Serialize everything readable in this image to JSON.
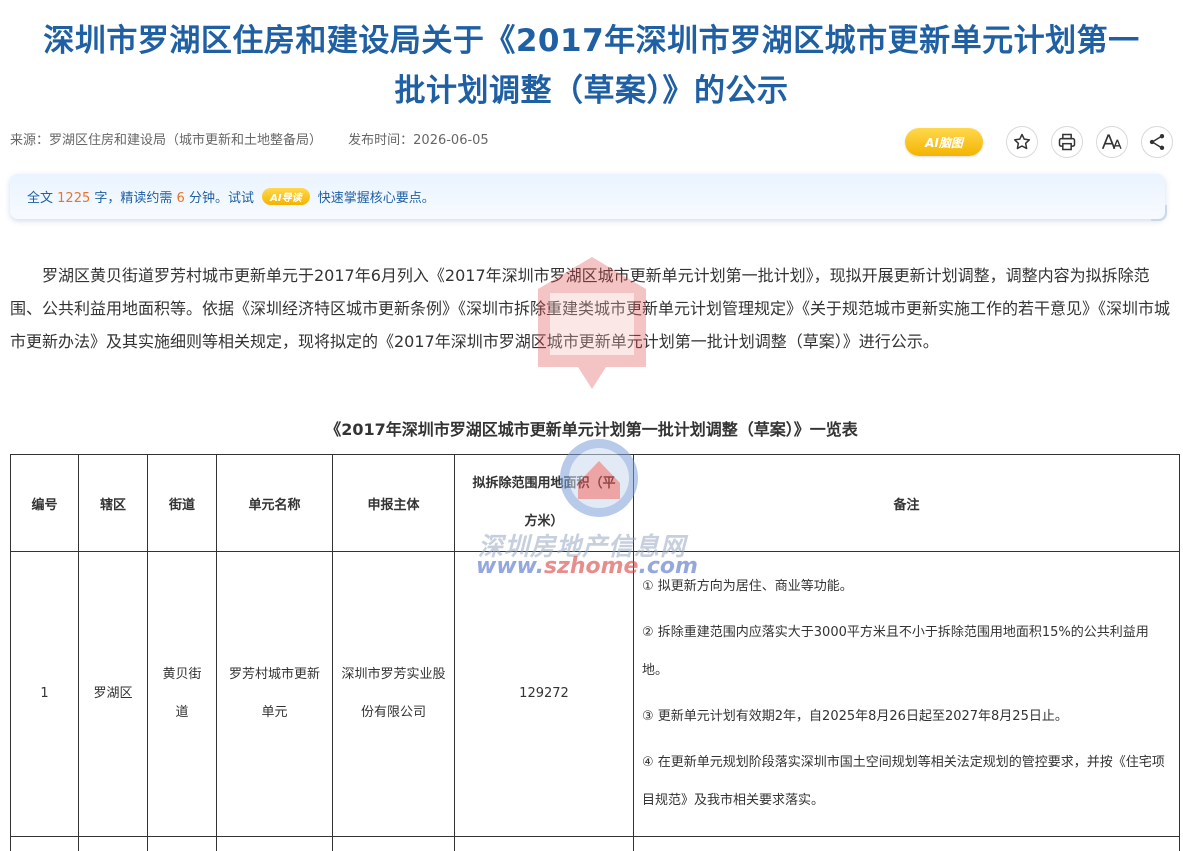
{
  "article": {
    "title_line1": "深圳市罗湖区住房和建设局关于《2017年深圳市罗湖区城市更新单元计划第一",
    "title_line2": "批计划调整（草案）》的公示",
    "source": "来源：罗湖区住房和建设局（城市更新和土地整备局）",
    "publish_time": "发布时间：2026-06-05"
  },
  "tools": {
    "ai_mindmap_label": "AI脑图",
    "icons": [
      "star-icon",
      "print-icon",
      "font-size-icon",
      "share-icon"
    ]
  },
  "summary": {
    "prefix": "全文",
    "word_count": "1225",
    "mid1": "字，精读约需",
    "minutes": "6",
    "mid2": "分钟。试试",
    "ai_tag": "AI导读",
    "suffix": "快速掌握核心要点。"
  },
  "body": {
    "paragraph": "罗湖区黄贝街道罗芳村城市更新单元于2017年6月列入《2017年深圳市罗湖区城市更新单元计划第一批计划》，现拟开展更新计划调整，调整内容为拟拆除范围、公共利益用地面积等。依据《深圳经济特区城市更新条例》《深圳市拆除重建类城市更新单元计划管理规定》《关于规范城市更新实施工作的若干意见》《深圳市城市更新办法》及其实施细则等相关规定，现将拟定的《2017年深圳市罗湖区城市更新单元计划第一批计划调整（草案）》进行公示。"
  },
  "watermark": {
    "text": "深圳房地产信息网",
    "url_a": "www.",
    "url_b": "szhome",
    "url_c": ".com"
  },
  "table": {
    "title": "《2017年深圳市罗湖区城市更新单元计划第一批计划调整（草案）》一览表",
    "headers": [
      "编号",
      "辖区",
      "街道",
      "单元名称",
      "申报主体",
      "拟拆除范围用地面积（平方米）",
      "备注"
    ],
    "rows": [
      {
        "no": "1",
        "district": "罗湖区",
        "street": "黄贝街道",
        "unit_name": "罗芳村城市更新单元",
        "applicant": "深圳市罗芳实业股份有限公司",
        "area": "129272",
        "remarks": [
          "① 拟更新方向为居住、商业等功能。",
          "② 拆除重建范围内应落实大于3000平方米且不小于拆除范围用地面积15%的公共利益用地。",
          "③ 更新单元计划有效期2年，自2025年8月26日起至2027年8月25日止。",
          "④ 在更新单元规划阶段落实深圳市国土空间规划等相关法定规划的管控要求，并按《住宅项目规范》及我市相关要求落实。"
        ]
      }
    ]
  },
  "colors": {
    "title_blue": "#1f5fa3",
    "accent_orange": "#e8742d",
    "ai_yellow": "#f4b400"
  }
}
